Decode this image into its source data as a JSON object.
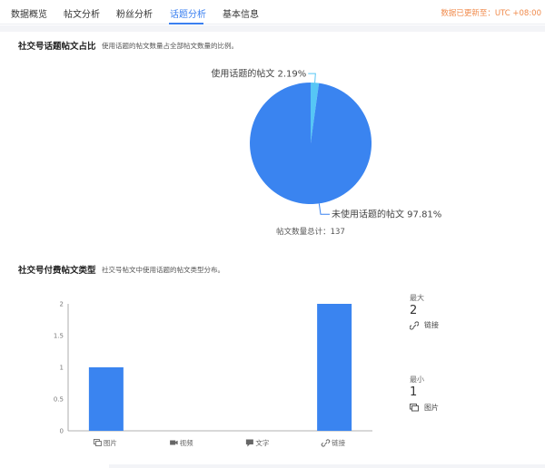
{
  "tabs": [
    {
      "label": "数据概览"
    },
    {
      "label": "帖文分析"
    },
    {
      "label": "粉丝分析"
    },
    {
      "label": "话题分析"
    },
    {
      "label": "基本信息"
    }
  ],
  "active_tab": "话题分析",
  "update_status": "数据已更新至：UTC +08:00",
  "accent_color": "#3a7ff0",
  "status_color": "#f08a4b",
  "section1": {
    "title": "社交号话题帖文占比",
    "desc": "使用话题的帖文数量占全部帖文数量的比例。",
    "total": "帖文数量总计：137"
  },
  "section2": {
    "title": "社交号付费帖文类型",
    "desc": "社交号帖文中使用话题的帖文类型分布。"
  },
  "chart_data": [
    {
      "type": "pie",
      "slices": [
        {
          "label": "使用话题的帖文",
          "value": 2.19,
          "value_label": "2.19%",
          "color": "#56c6f5"
        },
        {
          "label": "未使用话题的帖文",
          "value": 97.81,
          "value_label": "97.81%",
          "color": "#3a84f0"
        }
      ]
    },
    {
      "type": "bar",
      "categories": [
        "图片",
        "视频",
        "文字",
        "链接"
      ],
      "category_icons": [
        "image-icon",
        "video-icon",
        "chat-icon",
        "link-icon"
      ],
      "values": [
        1,
        0,
        0,
        2
      ],
      "ylim": [
        0,
        2
      ],
      "yticks": [
        "0",
        "0.5",
        "1",
        "1.5",
        "2"
      ],
      "bar_color": "#3a84f0"
    }
  ],
  "stats": {
    "max": {
      "label": "最大",
      "value": "2",
      "category": "链接",
      "icon": "link-icon"
    },
    "min": {
      "label": "最小",
      "value": "1",
      "category": "图片",
      "icon": "image-icon"
    }
  }
}
